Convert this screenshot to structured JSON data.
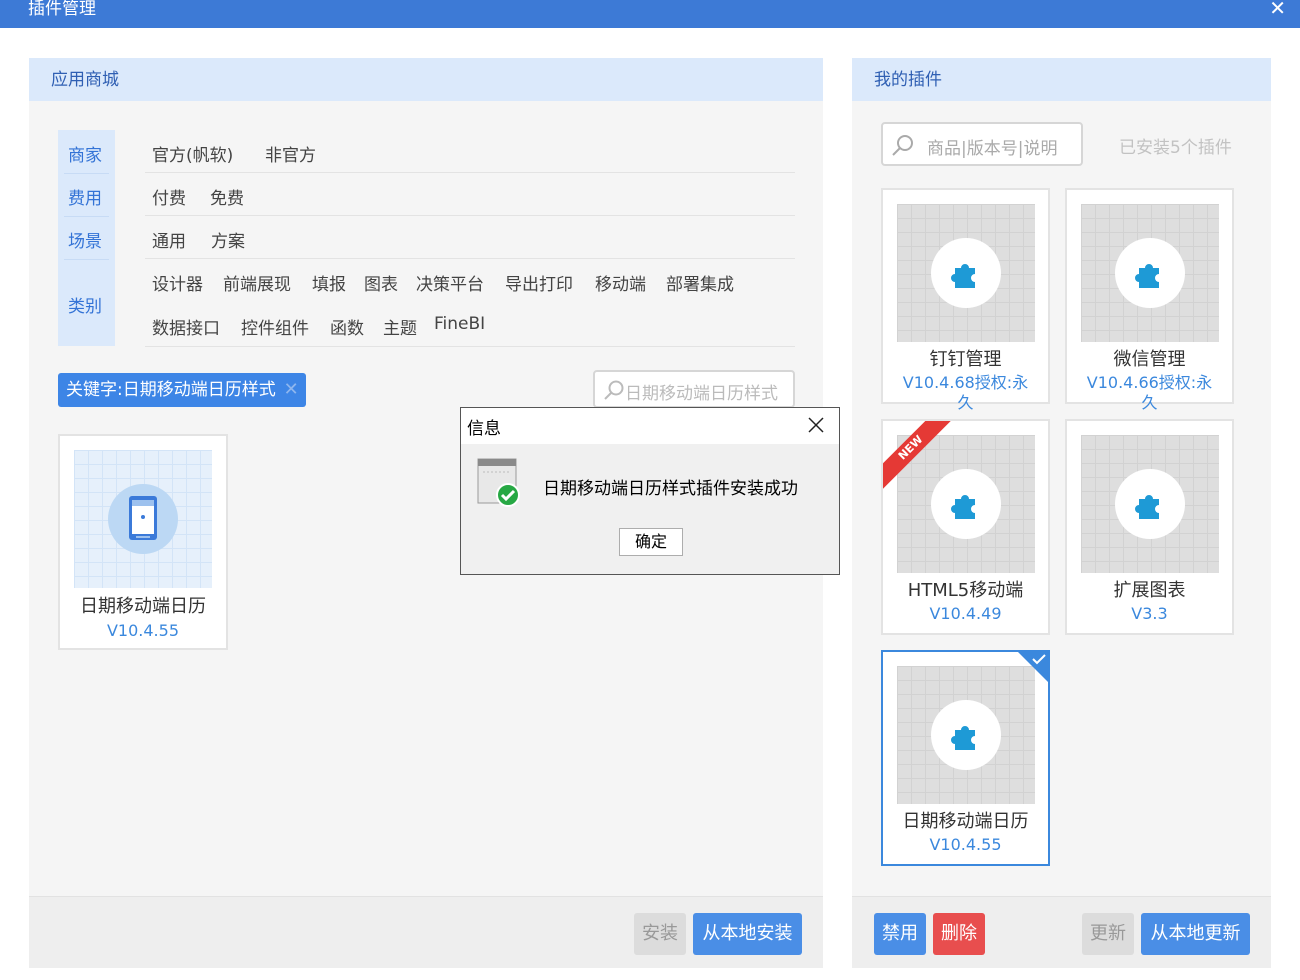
{
  "window": {
    "title": "插件管理",
    "close_icon": "✕"
  },
  "store": {
    "header": "应用商城",
    "filters": [
      {
        "label": "商家",
        "options": [
          "官方(帆软)",
          "非官方"
        ]
      },
      {
        "label": "费用",
        "options": [
          "付费",
          "免费"
        ]
      },
      {
        "label": "场景",
        "options": [
          "通用",
          "方案"
        ]
      },
      {
        "label": "类别",
        "options_row1": [
          "设计器",
          "前端展现",
          "填报",
          "图表",
          "决策平台",
          "导出打印",
          "移动端",
          "部署集成"
        ],
        "options_row2": [
          "数据接口",
          "控件组件",
          "函数",
          "主题",
          "FineBI"
        ]
      }
    ],
    "keyword_tag": "关键字:日期移动端日历样式",
    "keyword_tag_remove": "✕",
    "search_value": "日期移动端日历样式",
    "results": [
      {
        "name": "日期移动端日历",
        "version": "V10.4.55"
      }
    ],
    "footer": {
      "install": "安装",
      "install_local": "从本地安装"
    }
  },
  "mine": {
    "header": "我的插件",
    "search_placeholder": "商品|版本号|说明",
    "installed_count": "已安装5个插件",
    "plugins": [
      {
        "name": "钉钉管理",
        "version": "V10.4.68授权:永久"
      },
      {
        "name": "微信管理",
        "version": "V10.4.66授权:永久"
      },
      {
        "name": "HTML5移动端",
        "version": "V10.4.49",
        "badge": "NEW"
      },
      {
        "name": "扩展图表",
        "version": "V3.3"
      },
      {
        "name": "日期移动端日历",
        "version": "V10.4.55",
        "selected": true
      }
    ],
    "footer": {
      "disable": "禁用",
      "delete": "删除",
      "update": "更新",
      "update_local": "从本地更新"
    }
  },
  "dialog": {
    "title": "信息",
    "message": "日期移动端日历样式插件安装成功",
    "ok": "确定"
  },
  "colors": {
    "accent": "#3d7ad6",
    "link": "#3b88dd",
    "danger": "#e84e4e",
    "plugin_icon": "#1e9ad6",
    "success": "#27a844"
  }
}
